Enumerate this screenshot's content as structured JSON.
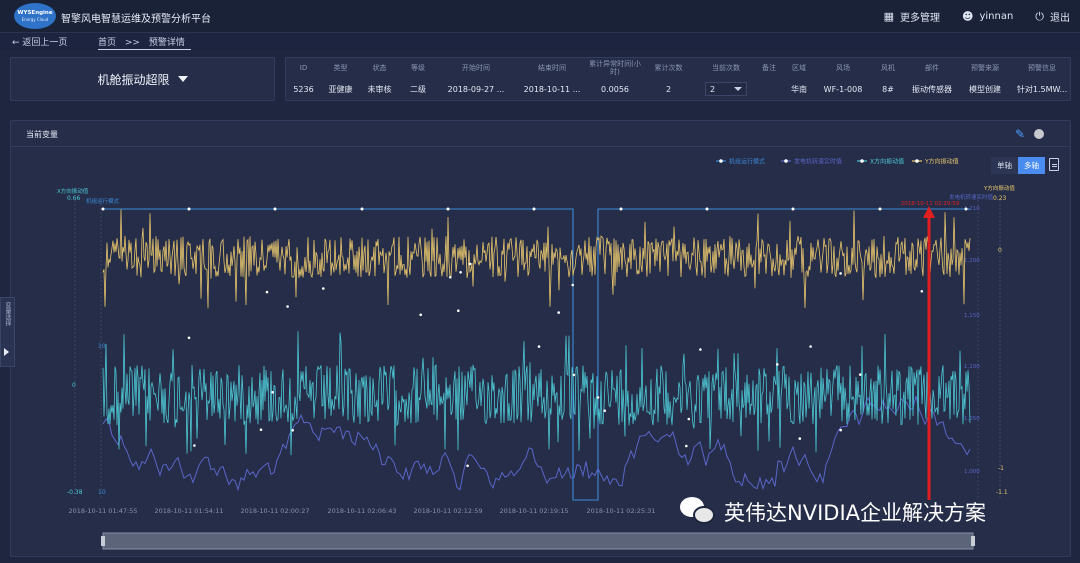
{
  "header": {
    "logo_text": "WYSEngine",
    "logo_sub": "Energy Cloud",
    "app_title": "智擎风电智慧运维及预警分析平台",
    "more_label": "更多管理",
    "user_label": "yinnan",
    "logout_label": "退出"
  },
  "breadcrumb": {
    "back_label": "返回上一页",
    "home": "首页",
    "sep": ">>",
    "current": "预警详情"
  },
  "alarm_selector": {
    "label": "机舱振动超限"
  },
  "info": {
    "headers": [
      "ID",
      "类型",
      "状态",
      "等级",
      "开始时间",
      "结束时间",
      "累计异常时间(小时)",
      "累计次数",
      "当前次数",
      "备注",
      "区域",
      "风场",
      "风机",
      "部件",
      "预警来源",
      "预警信息"
    ],
    "values": [
      "5236",
      "亚健康",
      "未审核",
      "二级",
      "2018-09-27 ...",
      "2018-10-11 ...",
      "0.0056",
      "2",
      "2",
      "",
      "华南",
      "WF-1-008",
      "8#",
      "振动传感器",
      "模型创建",
      "针对1.5MW..."
    ]
  },
  "panel": {
    "title": "当前变量",
    "side_tab_label": "变量选择",
    "axis_single": "单轴",
    "axis_multi": "多轴"
  },
  "chart_data": {
    "type": "line",
    "legend": [
      "机组运行模式",
      "发电机转速实时值",
      "X方向振动值",
      "Y方向振动值"
    ],
    "legend_position": "top-right",
    "x_tick_labels": [
      "2018-10-11 01:47:55",
      "2018-10-11 01:54:11",
      "2018-10-11 02:00:27",
      "2018-10-11 02:06:43",
      "2018-10-11 02:12:59",
      "2018-10-11 02:19:15",
      "2018-10-11 02:25:31"
    ],
    "left_axis_labels": {
      "title_x": "X方向振动值",
      "title_mode": "机组运行模式",
      "top": "0.66",
      "mid": "0",
      "bottom": "-0.38",
      "mode_top": "10",
      "mode_bottom": "10"
    },
    "right_axis_labels": {
      "title_y": "Y方向振动值",
      "title_speed": "发电机转速实时值",
      "y_top": "0.23",
      "y_mid": "0",
      "y_low": "-1",
      "y_bottom": "-1.1",
      "speed_1": "1,210",
      "speed_2": "1,200",
      "speed_3": "1,150",
      "speed_4": "1,100",
      "speed_5": "1,050",
      "speed_6": "1,000"
    },
    "marker_label": "2018-10-11 02:29:59",
    "series": [
      {
        "name": "机组运行模式",
        "color": "#3c8ad8",
        "note": "step line: high 10 with a dip at around 02:20"
      },
      {
        "name": "发电机转速实时值",
        "color": "#5a66c8"
      },
      {
        "name": "X方向振动值",
        "color": "#4ec8d4"
      },
      {
        "name": "Y方向振动值",
        "color": "#e9c76e"
      }
    ]
  },
  "watermark": {
    "text": "英伟达NVIDIA企业解决方案"
  }
}
